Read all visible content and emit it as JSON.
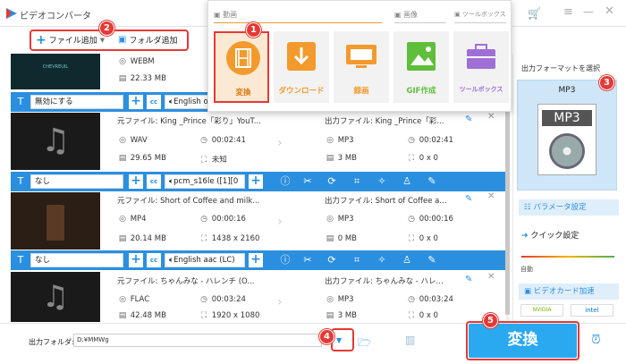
{
  "app": {
    "title": "ビデオコンバータ"
  },
  "toolbar": {
    "add_file": "ファイル追加",
    "add_folder": "フォルダ追加"
  },
  "badges": [
    "1",
    "2",
    "3",
    "4",
    "5"
  ],
  "panel": {
    "section_video": "動画",
    "section_image": "画像",
    "section_toolbox": "ツールボックス",
    "tiles": [
      {
        "label": "変換",
        "icon": "film-icon",
        "color": "#f39a2d"
      },
      {
        "label": "ダウンロード",
        "icon": "download-icon",
        "color": "#f39a2d"
      },
      {
        "label": "録画",
        "icon": "screen-record-icon",
        "color": "#f39a2d"
      },
      {
        "label": "GIF作成",
        "icon": "image-icon",
        "color": "#5fbf3a"
      },
      {
        "label": "ツールボックス",
        "icon": "toolbox-icon",
        "color": "#a06fd6"
      }
    ]
  },
  "rows": [
    {
      "src_format": "WEBM",
      "src_size": "22.33 MB",
      "subtitle": "無効にする",
      "audio": "English opu",
      "thumb_text": "CHEVREUIL"
    },
    {
      "src_name": "元ファイル: King _Prince「彩り」YouT...",
      "src_format": "WAV",
      "src_duration": "00:02:41",
      "src_size": "29.65 MB",
      "src_res": "未知",
      "out_name": "出力ファイル: King _Prince「彩...",
      "out_format": "MP3",
      "out_duration": "00:02:41",
      "out_size": "3 MB",
      "out_res": "0 x 0",
      "subtitle": "なし",
      "audio": "pcm_s16le ([1][0"
    },
    {
      "src_name": "元ファイル: Short of Coffee and milk...",
      "src_format": "MP4",
      "src_duration": "00:00:16",
      "src_size": "20.14 MB",
      "src_res": "1438 x 2160",
      "out_name": "出力ファイル: Short of Coffee a...",
      "out_format": "MP3",
      "out_duration": "00:00:16",
      "out_size": "0 MB",
      "out_res": "0 x 0",
      "subtitle": "なし",
      "audio": "English aac (LC)"
    },
    {
      "src_name": "元ファイル: ちゃんみな - ハレンチ (O...",
      "src_format": "FLAC",
      "src_duration": "00:03:24",
      "src_size": "42.48 MB",
      "src_res": "1920 x 1080",
      "out_name": "出力ファイル: ちゃんみな - ハレ...",
      "out_format": "MP3",
      "out_duration": "00:03:24",
      "out_size": "3 MB",
      "out_res": "0 x 0"
    }
  ],
  "sidebar": {
    "select_format": "出力フォーマットを選択",
    "format": "MP3",
    "format_badge": "MP3",
    "param_settings": "パラメータ設定",
    "quick_settings": "クイック設定",
    "auto_label": "自動",
    "gpu_accel": "ビデオカード加速",
    "nvidia": "NVIDIA",
    "intel": "intel"
  },
  "bottom": {
    "output_folder_label": "出力フォルダ:",
    "output_folder_value": "D:¥MMWg",
    "convert": "変換"
  }
}
